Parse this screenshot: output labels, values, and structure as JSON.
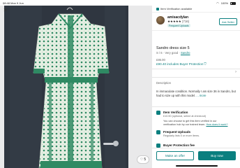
{
  "status_bar": {
    "time": "08:48 Mon 9 Jun",
    "battery": "100%"
  },
  "photo": {
    "close_glyph": "✕",
    "favourite_count": "5",
    "colors": {
      "dress_base": "#e6efe3",
      "dress_print": "#2f8a63",
      "door": "#2f3640"
    }
  },
  "banner": {
    "text": "Item Verification available"
  },
  "seller": {
    "username": "amisacdylan",
    "rating_stars": "★★★★★",
    "rating_count": "(716)",
    "badge": "Frequent Uploads",
    "ask_label": "Ask Seller"
  },
  "item": {
    "title": "Sandro dress size 5",
    "size": "S / 6",
    "condition": "Very good",
    "brand": "Sandro",
    "price": "£86.00",
    "price_with_protection": "£90.40 includes Buyer Protection"
  },
  "description": {
    "label": "Description",
    "text": "In immaculate condition. Normally I am size 36 in Sandro, but had to size up with this model.",
    "more": "... more"
  },
  "features": [
    {
      "title": "Item Verification",
      "subtitle": "£10.50 (optional, select at checkout)",
      "subtitle2": "You can choose to get this item verified in our",
      "subtitle3": "verification hub by our trained team.",
      "link": "How does it work?"
    },
    {
      "title": "Frequent Uploads",
      "subtitle": "Regularly lists 5 or more items."
    },
    {
      "title": "Buyer Protection fee"
    }
  ],
  "actions": {
    "offer_label": "Make an offer",
    "buy_label": "Buy now"
  },
  "accent": "#0a7f7f"
}
